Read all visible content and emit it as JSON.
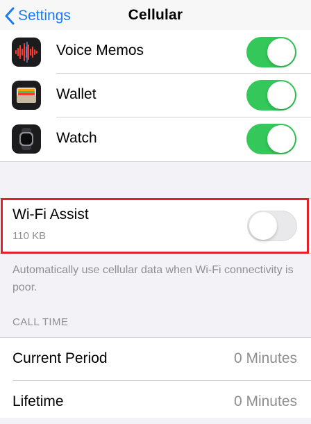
{
  "nav": {
    "back_label": "Settings",
    "title": "Cellular"
  },
  "apps": [
    {
      "name": "Voice Memos",
      "icon": "voice-memos-icon",
      "enabled": true
    },
    {
      "name": "Wallet",
      "icon": "wallet-icon",
      "enabled": true
    },
    {
      "name": "Watch",
      "icon": "watch-icon",
      "enabled": true
    }
  ],
  "wifi_assist": {
    "title": "Wi-Fi Assist",
    "usage": "110 KB",
    "enabled": false,
    "footer": "Automatically use cellular data when Wi-Fi connectivity is poor."
  },
  "call_time": {
    "header": "CALL TIME",
    "rows": [
      {
        "label": "Current Period",
        "value": "0 Minutes"
      },
      {
        "label": "Lifetime",
        "value": "0 Minutes"
      }
    ]
  },
  "colors": {
    "accent": "#1a7cf5",
    "toggle_on": "#34c759",
    "highlight": "#e0202c"
  }
}
